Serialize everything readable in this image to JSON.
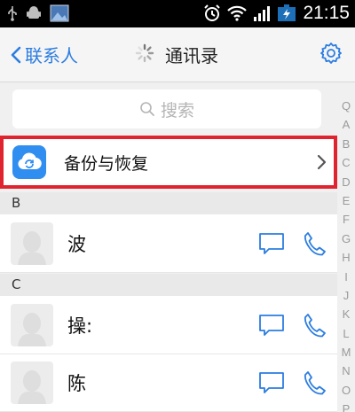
{
  "status_bar": {
    "time": "21:15"
  },
  "nav": {
    "back_label": "联系人",
    "title": "通讯录"
  },
  "search": {
    "placeholder": "搜索"
  },
  "backup": {
    "label": "备份与恢复"
  },
  "sections": [
    {
      "header": "B",
      "contacts": [
        {
          "name": "波"
        }
      ]
    },
    {
      "header": "C",
      "contacts": [
        {
          "name": "操:"
        },
        {
          "name": "陈"
        }
      ]
    }
  ],
  "alpha_index": [
    "Q",
    "A",
    "B",
    "C",
    "D",
    "E",
    "F",
    "G",
    "H",
    "I",
    "J",
    "K",
    "L",
    "M",
    "N",
    "O",
    "P"
  ],
  "colors": {
    "accent": "#2b7de0",
    "highlight_border": "#e0242f",
    "backup_icon_bg": "#2f8ef0"
  }
}
